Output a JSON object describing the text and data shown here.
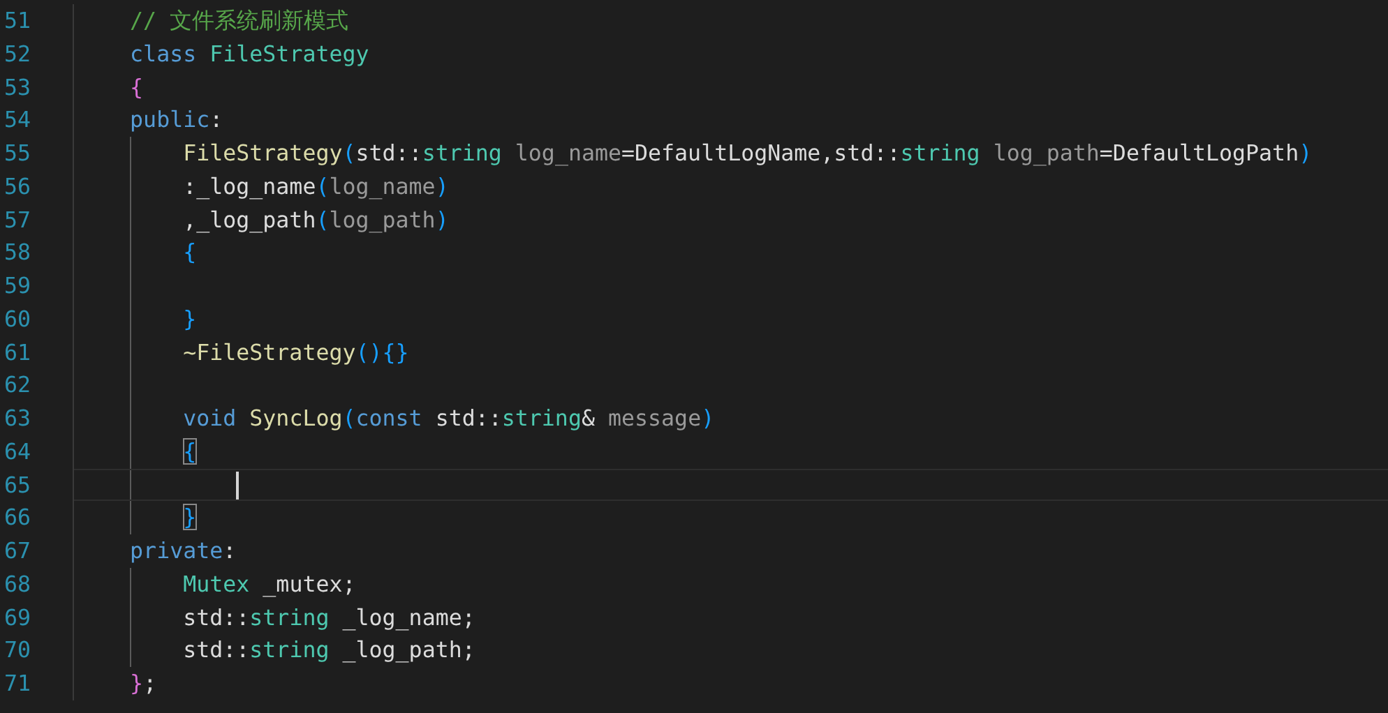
{
  "editor": {
    "lines": [
      {
        "number": "51",
        "tokens": [
          {
            "text": "    // 文件系统刷新模式",
            "kind": "comment"
          }
        ]
      },
      {
        "number": "52",
        "tokens": [
          {
            "text": "    class",
            "kind": "keyword"
          },
          {
            "text": " FileStrategy",
            "kind": "type"
          }
        ]
      },
      {
        "number": "53",
        "tokens": [
          {
            "text": "    {",
            "kind": "bracket-outer"
          }
        ]
      },
      {
        "number": "54",
        "tokens": [
          {
            "text": "    public",
            "kind": "keyword"
          },
          {
            "text": ":",
            "kind": "plain"
          }
        ]
      },
      {
        "number": "55",
        "tokens": [
          {
            "text": "        FileStrategy",
            "kind": "function"
          },
          {
            "text": "(",
            "kind": "bracket-inner"
          },
          {
            "text": "std::",
            "kind": "plain"
          },
          {
            "text": "string",
            "kind": "type"
          },
          {
            "text": " log_name",
            "kind": "param"
          },
          {
            "text": "=DefaultLogName,std::",
            "kind": "plain"
          },
          {
            "text": "string",
            "kind": "type"
          },
          {
            "text": " log_path",
            "kind": "param"
          },
          {
            "text": "=DefaultLogPath",
            "kind": "plain"
          },
          {
            "text": ")",
            "kind": "bracket-inner"
          }
        ]
      },
      {
        "number": "56",
        "tokens": [
          {
            "text": "        :_log_name",
            "kind": "plain"
          },
          {
            "text": "(",
            "kind": "bracket-inner"
          },
          {
            "text": "log_name",
            "kind": "param"
          },
          {
            "text": ")",
            "kind": "bracket-inner"
          }
        ]
      },
      {
        "number": "57",
        "tokens": [
          {
            "text": "        ,_log_path",
            "kind": "plain"
          },
          {
            "text": "(",
            "kind": "bracket-inner"
          },
          {
            "text": "log_path",
            "kind": "param"
          },
          {
            "text": ")",
            "kind": "bracket-inner"
          }
        ]
      },
      {
        "number": "58",
        "tokens": [
          {
            "text": "        {",
            "kind": "bracket-inner"
          }
        ]
      },
      {
        "number": "59"
      },
      {
        "number": "60",
        "tokens": [
          {
            "text": "        }",
            "kind": "bracket-inner"
          }
        ]
      },
      {
        "number": "61",
        "tokens": [
          {
            "text": "        ~FileStrategy",
            "kind": "function"
          },
          {
            "text": "(){}",
            "kind": "bracket-inner"
          }
        ]
      },
      {
        "number": "62"
      },
      {
        "number": "63",
        "tokens": [
          {
            "text": "        void",
            "kind": "keyword"
          },
          {
            "text": " SyncLog",
            "kind": "function"
          },
          {
            "text": "(",
            "kind": "bracket-inner"
          },
          {
            "text": "const",
            "kind": "keyword"
          },
          {
            "text": " std::",
            "kind": "plain"
          },
          {
            "text": "string",
            "kind": "type"
          },
          {
            "text": "& ",
            "kind": "plain"
          },
          {
            "text": "message",
            "kind": "param"
          },
          {
            "text": ")",
            "kind": "bracket-inner"
          }
        ]
      },
      {
        "number": "64",
        "tokens": [
          {
            "text": "        {",
            "kind": "bracket-inner",
            "matched": true
          }
        ]
      },
      {
        "number": "65",
        "current": true
      },
      {
        "number": "66",
        "tokens": [
          {
            "text": "        }",
            "kind": "bracket-inner",
            "matched": true
          }
        ]
      },
      {
        "number": "67",
        "tokens": [
          {
            "text": "    private",
            "kind": "keyword"
          },
          {
            "text": ":",
            "kind": "plain"
          }
        ]
      },
      {
        "number": "68",
        "tokens": [
          {
            "text": "        Mutex",
            "kind": "type"
          },
          {
            "text": " _mutex;",
            "kind": "plain"
          }
        ]
      },
      {
        "number": "69",
        "tokens": [
          {
            "text": "        std::",
            "kind": "plain"
          },
          {
            "text": "string",
            "kind": "type"
          },
          {
            "text": " _log_name;",
            "kind": "plain"
          }
        ]
      },
      {
        "number": "70",
        "tokens": [
          {
            "text": "        std::",
            "kind": "plain"
          },
          {
            "text": "string",
            "kind": "type"
          },
          {
            "text": " _log_path;",
            "kind": "plain"
          }
        ]
      },
      {
        "number": "71",
        "tokens": [
          {
            "text": "    }",
            "kind": "bracket-outer"
          },
          {
            "text": ";",
            "kind": "plain"
          }
        ]
      }
    ]
  }
}
